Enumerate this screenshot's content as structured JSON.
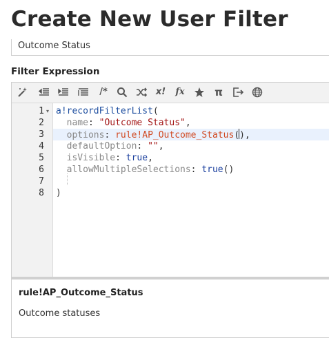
{
  "page": {
    "title": "Create New User Filter"
  },
  "name_field": {
    "value": "Outcome Status"
  },
  "expression": {
    "label": "Filter Expression",
    "toolbar_icons": [
      "magic-wand-icon",
      "outdent-icon",
      "indent-icon",
      "align-icon",
      "comment-icon",
      "search-icon",
      "shuffle-icon",
      "not-icon",
      "function-icon",
      "star-icon",
      "pi-icon",
      "export-icon",
      "globe-icon"
    ],
    "toolbar_glyphs": {
      "comment": "/*",
      "not": "x!",
      "function": "fx",
      "pi": "π"
    },
    "line_numbers": [
      "1",
      "2",
      "3",
      "4",
      "5",
      "6",
      "7",
      "8"
    ],
    "lines": [
      {
        "indent": "",
        "tokens": [
          {
            "t": "fn",
            "v": "a!recordFilterList"
          },
          {
            "t": "punc",
            "v": "("
          }
        ]
      },
      {
        "indent": "  ",
        "tokens": [
          {
            "t": "key",
            "v": "name"
          },
          {
            "t": "punc",
            "v": ": "
          },
          {
            "t": "str",
            "v": "\"Outcome Status\""
          },
          {
            "t": "punc",
            "v": ","
          }
        ]
      },
      {
        "indent": "  ",
        "tokens": [
          {
            "t": "key",
            "v": "options"
          },
          {
            "t": "punc",
            "v": ": "
          },
          {
            "t": "rule",
            "v": "rule!AP_Outcome_Status"
          },
          {
            "t": "punc",
            "v": "("
          },
          {
            "t": "cursor",
            "v": ""
          },
          {
            "t": "punc",
            "v": "),"
          }
        ]
      },
      {
        "indent": "  ",
        "tokens": [
          {
            "t": "key",
            "v": "defaultOption"
          },
          {
            "t": "punc",
            "v": ": "
          },
          {
            "t": "str",
            "v": "\"\""
          },
          {
            "t": "punc",
            "v": ","
          }
        ]
      },
      {
        "indent": "  ",
        "tokens": [
          {
            "t": "key",
            "v": "isVisible"
          },
          {
            "t": "punc",
            "v": ": "
          },
          {
            "t": "kw",
            "v": "true"
          },
          {
            "t": "punc",
            "v": ","
          }
        ]
      },
      {
        "indent": "  ",
        "tokens": [
          {
            "t": "key",
            "v": "allowMultipleSelections"
          },
          {
            "t": "punc",
            "v": ": "
          },
          {
            "t": "kw",
            "v": "true"
          },
          {
            "t": "punc",
            "v": "()"
          }
        ]
      },
      {
        "indent": "",
        "tokens": []
      },
      {
        "indent": "",
        "tokens": [
          {
            "t": "punc",
            "v": ")"
          }
        ]
      }
    ],
    "active_line_index": 2,
    "fold_marker": "▾"
  },
  "doc_panel": {
    "title": "rule!AP_Outcome_Status",
    "description": "Outcome statuses"
  },
  "colors": {
    "function": "#1f4fa0",
    "string": "#a31515",
    "keyword": "#1a3f9e",
    "rule": "#d14a23",
    "param": "#888888",
    "active_line": "#e9f1fd"
  }
}
